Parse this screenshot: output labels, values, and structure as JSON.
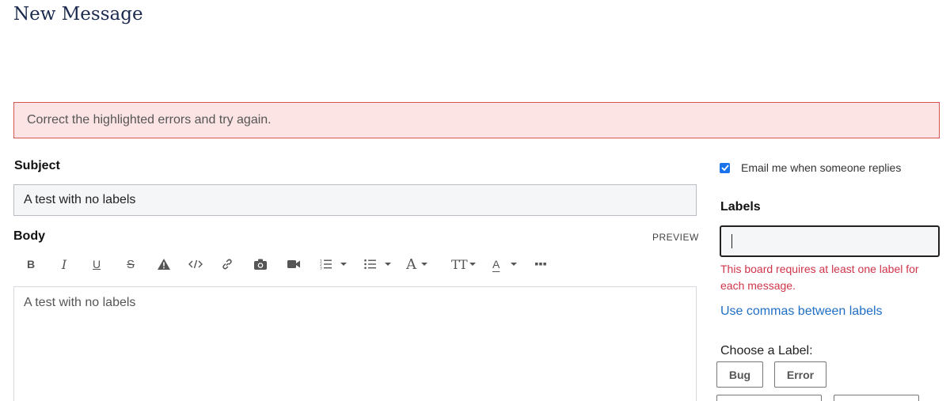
{
  "page": {
    "title": "New Message"
  },
  "alert": {
    "text": "Correct the highlighted errors and try again."
  },
  "subject": {
    "label": "Subject",
    "value": "A test with no labels"
  },
  "body": {
    "label": "Body",
    "preview_label": "PREVIEW",
    "content": "A test with no labels"
  },
  "toolbar": {
    "bold": "B",
    "italic": "I",
    "underline": "U",
    "strikethrough": "S",
    "font_color_glyph": "A",
    "text_size_glyph": "TT",
    "font_face_glyph": "A"
  },
  "options": {
    "email_notify_label": "Email me when someone replies",
    "email_notify_checked": true
  },
  "labels": {
    "title": "Labels",
    "input_value": "",
    "error": "This board requires at least one label for each message.",
    "help_link": "Use commas between labels",
    "choose_title": "Choose a Label:",
    "chips": [
      "Bug",
      "Error"
    ]
  },
  "colors": {
    "accent": "#1a73e8",
    "error": "#d0344a",
    "link": "#1f6fc5",
    "title": "#1b2a4e"
  }
}
